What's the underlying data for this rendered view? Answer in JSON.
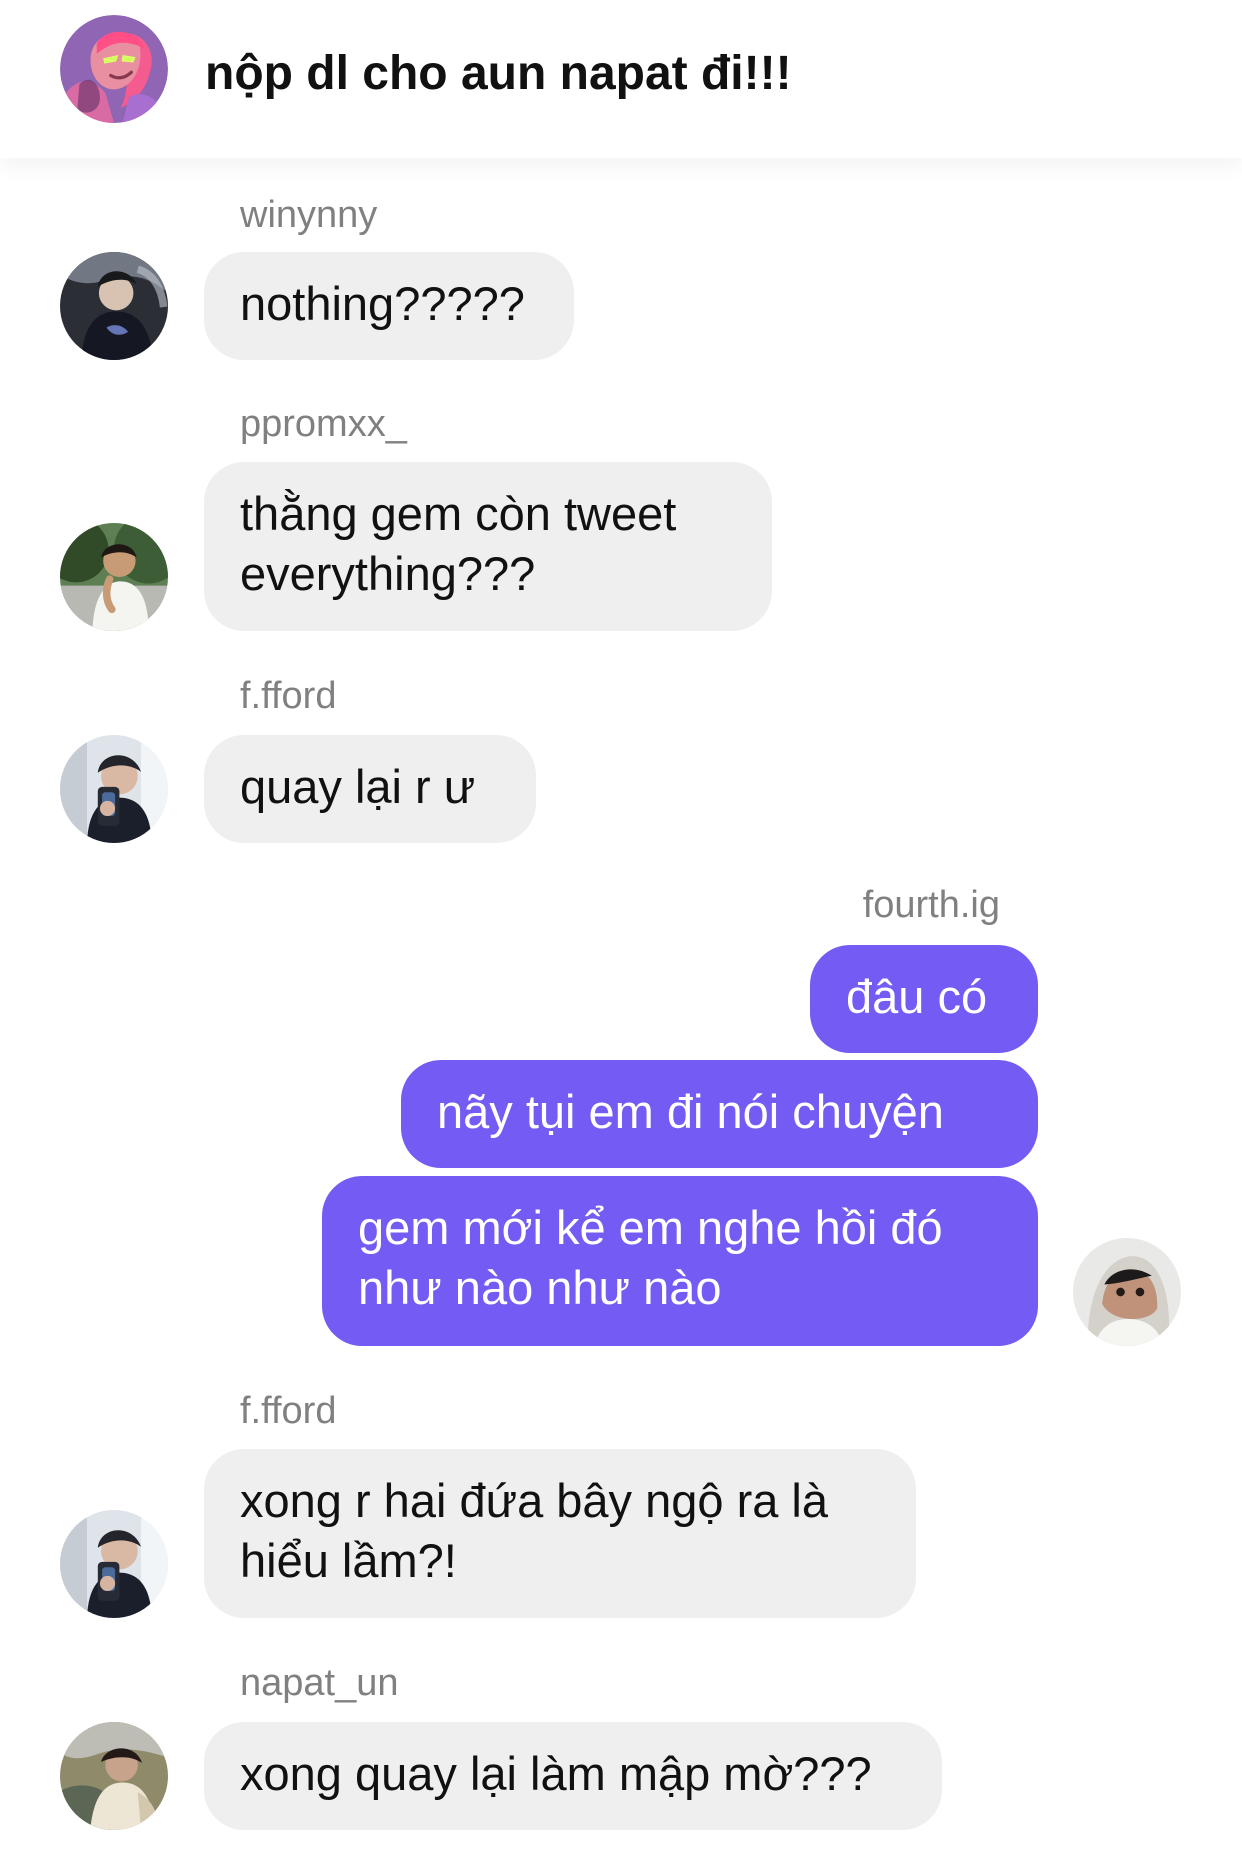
{
  "chat": {
    "title": "nộp dl cho aun napat đi!!!",
    "group_avatar_icon": "group-avatar-icon"
  },
  "messages": [
    {
      "sender": "winynny",
      "text": "nothing?????",
      "direction": "incoming"
    },
    {
      "sender": "ppromxx_",
      "text": "thằng gem còn tweet\neverything???",
      "direction": "incoming"
    },
    {
      "sender": "f.fford",
      "text": "quay lại r ư",
      "direction": "incoming"
    },
    {
      "sender": "fourth.ig",
      "direction": "outgoing",
      "bubbles": [
        "đâu có",
        "nãy tụi em đi nói chuyện",
        "gem mới kể em nghe hồi đó\nnhư nào như nào"
      ]
    },
    {
      "sender": "f.fford",
      "text": "xong r hai đứa bây ngộ ra là\nhiểu lầm?!",
      "direction": "incoming"
    },
    {
      "sender": "napat_un",
      "text": "xong quay lại làm mập mờ???",
      "direction": "incoming"
    }
  ],
  "colors": {
    "incoming_bubble": "#efefef",
    "outgoing_bubble": "#745bf4",
    "sender_name": "#808080",
    "text": "#111111"
  }
}
